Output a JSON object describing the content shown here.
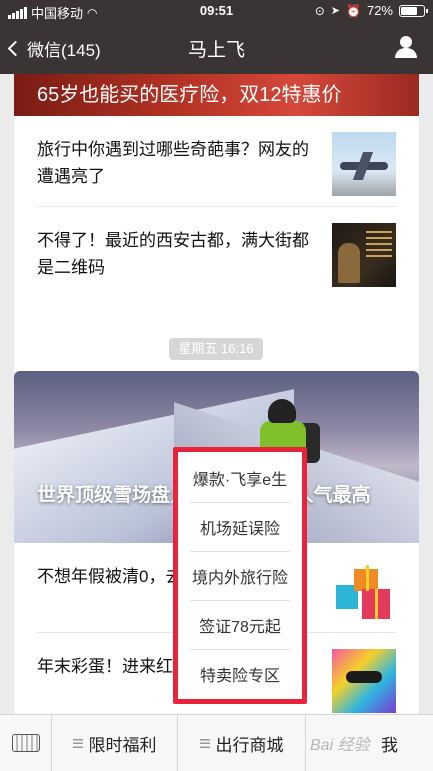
{
  "status_bar": {
    "carrier": "中国移动",
    "time": "09:51",
    "battery": "72%",
    "battery_level": 0.72
  },
  "nav": {
    "back_label": "微信(145)",
    "title": "马上飞"
  },
  "article_group_1": {
    "banner_title": "65岁也能买的医疗险，双12特惠价",
    "items": [
      {
        "title": "旅行中你遇到过哪些奇葩事？网友的遭遇亮了"
      },
      {
        "title": "不得了！最近的西安古都，满大街都是二维码"
      }
    ]
  },
  "timestamp": "星期五 16:16",
  "article_group_2": {
    "hero_title": "世界顶级雪场盘点，中国这2个人气最高",
    "items": [
      {
        "title": "不想年假被清0，去浪！"
      },
      {
        "title": "年末彩蛋！进来红包！"
      }
    ]
  },
  "popup_menu": {
    "items": [
      "爆款·飞享e生",
      "机场延误险",
      "境内外旅行险",
      "签证78元起",
      "特卖险专区"
    ]
  },
  "bottom_menu": {
    "items": [
      "限时福利",
      "出行商城",
      "我"
    ]
  },
  "watermark": "Bai 经验",
  "colors": {
    "nav_bg": "#3a3434",
    "popup_border": "#e8243d",
    "page_bg": "#ebebeb"
  }
}
